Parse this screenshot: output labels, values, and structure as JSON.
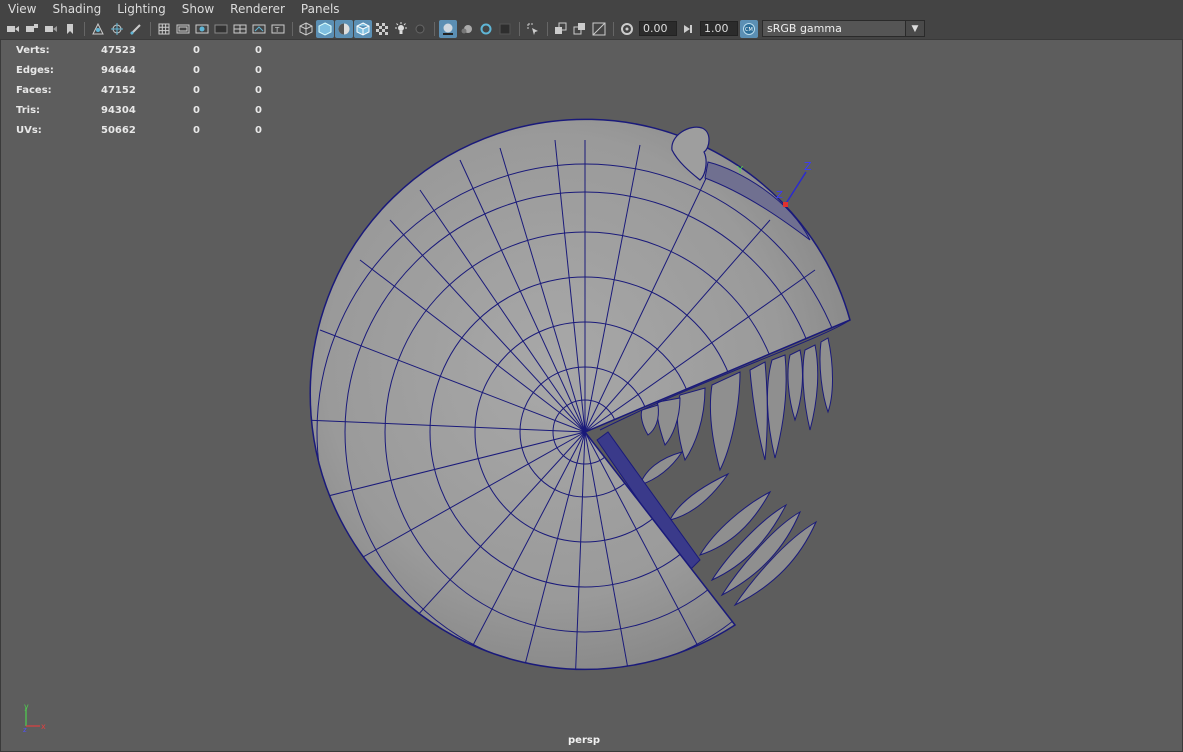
{
  "menu": [
    "View",
    "Shading",
    "Lighting",
    "Show",
    "Renderer",
    "Panels"
  ],
  "toolbar": {
    "exposure": "0.00",
    "gamma": "1.00",
    "color_space": "sRGB gamma"
  },
  "hud": {
    "rows": [
      {
        "label": "Verts:",
        "v1": "47523",
        "v2": "0",
        "v3": "0"
      },
      {
        "label": "Edges:",
        "v1": "94644",
        "v2": "0",
        "v3": "0"
      },
      {
        "label": "Faces:",
        "v1": "47152",
        "v2": "0",
        "v3": "0"
      },
      {
        "label": "Tris:",
        "v1": "94304",
        "v2": "0",
        "v3": "0"
      },
      {
        "label": "UVs:",
        "v1": "50662",
        "v2": "0",
        "v3": "0"
      }
    ]
  },
  "camera": "persp",
  "axes": {
    "y": "y",
    "x": "x",
    "z": "z"
  },
  "colors": {
    "wire": "#1a1a7a",
    "mesh": "#9a9a9a",
    "viewport": "#5d5d5d",
    "panel": "#444444",
    "active": "#5b8fb4"
  }
}
